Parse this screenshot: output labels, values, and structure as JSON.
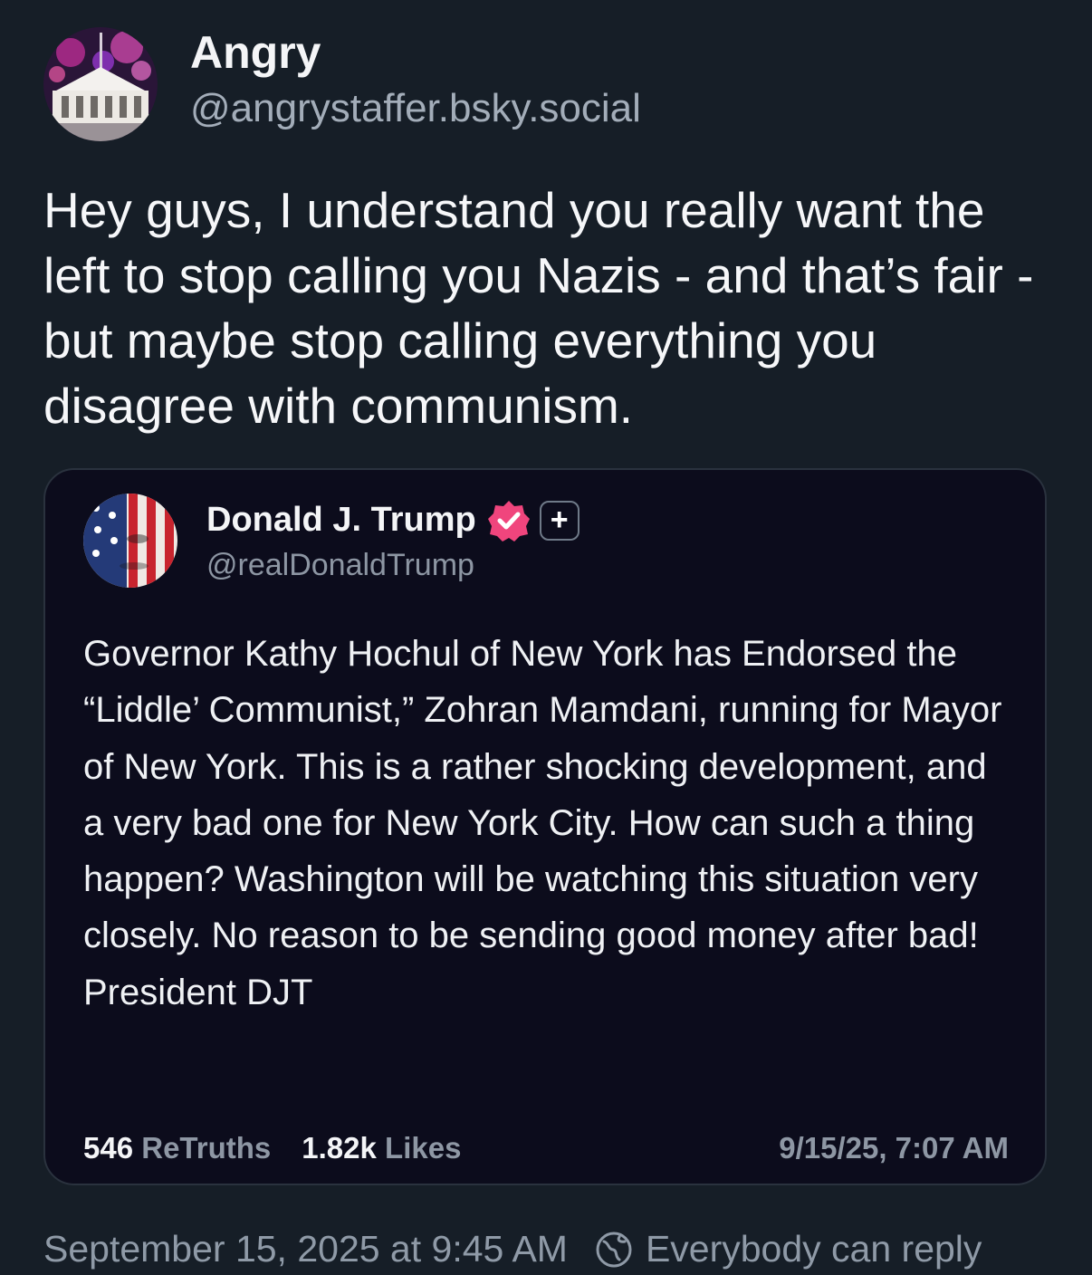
{
  "post": {
    "author": {
      "display_name": "Angry",
      "handle": "@angrystaffer.bsky.social",
      "avatar_icon": "white-house-fireworks-avatar"
    },
    "text": "Hey guys, I understand you really want the left to stop calling you Nazis - and that’s fair - but maybe stop calling everything you disagree with communism.",
    "timestamp": "September 15, 2025 at 9:45 AM",
    "reply_setting": "Everybody can reply",
    "reply_icon": "globe-icon"
  },
  "quote": {
    "author": {
      "display_name": "Donald J. Trump",
      "handle": "@realDonaldTrump",
      "avatar_icon": "flag-face-avatar",
      "verified_icon": "verified-badge-icon",
      "plus_icon": "plus-badge-icon",
      "plus_label": "+"
    },
    "text": "Governor Kathy Hochul of New York has Endorsed the “Liddle’ Communist,” Zohran Mamdani, running for Mayor of New York. This is a rather shocking development, and a very bad one for New York City. How can such a thing happen? Washington will be watching this situation very closely. No reason to be sending good money after bad! President DJT",
    "stats": {
      "retruths_count": "546",
      "retruths_label": "ReTruths",
      "likes_count": "1.82k",
      "likes_label": "Likes"
    },
    "timestamp": "9/15/25, 7:07 AM"
  },
  "colors": {
    "background": "#161e27",
    "card_background": "#0c0c1c",
    "verified_badge": "#f0457d",
    "muted_text": "#8f9aa7"
  }
}
